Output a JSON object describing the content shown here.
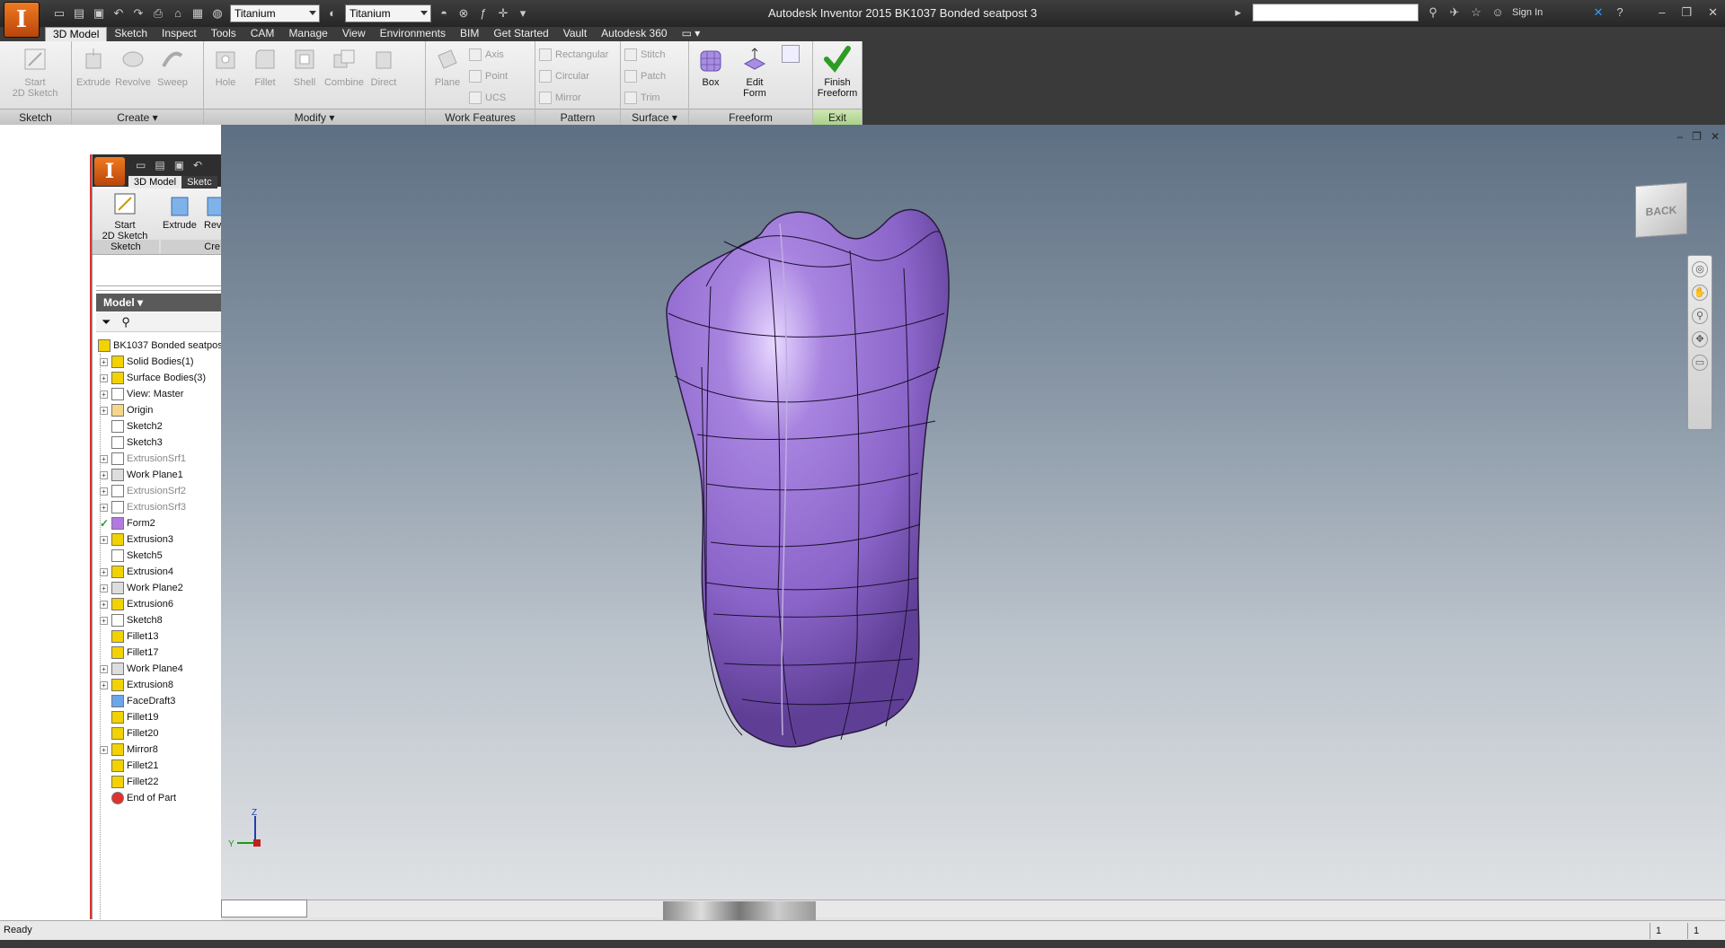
{
  "window": {
    "title": "Autodesk Inventor 2015   BK1037 Bonded seatpost 3",
    "material": "Titanium",
    "appearance": "Titanium",
    "sign_in": "Sign In",
    "search_placeholder": ""
  },
  "tabs": [
    "3D Model",
    "Sketch",
    "Inspect",
    "Tools",
    "CAM",
    "Manage",
    "View",
    "Environments",
    "BIM",
    "Get Started",
    "Vault",
    "Autodesk 360"
  ],
  "ribbon": {
    "sketch": {
      "start": "Start\n2D Sketch",
      "label": "Sketch"
    },
    "create": {
      "tools": [
        "Extrude",
        "Revolve",
        "Sweep"
      ],
      "label": "Create"
    },
    "modify": {
      "tools": [
        "Hole",
        "Fillet",
        "Shell",
        "Combine",
        "Direct"
      ],
      "label": "Modify"
    },
    "work": {
      "plane": "Plane",
      "axis": "Axis",
      "point": "Point",
      "ucs": "UCS",
      "label": "Work Features"
    },
    "pattern": {
      "rect": "Rectangular",
      "circ": "Circular",
      "mirror": "Mirror",
      "label": "Pattern"
    },
    "surface": {
      "stitch": "Stitch",
      "patch": "Patch",
      "trim": "Trim",
      "label": "Surface"
    },
    "freeform": {
      "box": "Box",
      "edit_form": "Edit\nForm",
      "label": "Freeform"
    },
    "exit": {
      "finish": "Finish\nFreeform",
      "label": "Exit"
    }
  },
  "inner": {
    "tab1": "3D Model",
    "tab2": "Sketc",
    "start": "Start\n2D Sketch",
    "extrude": "Extrude",
    "rev": "Rev",
    "sketch_label": "Sketch",
    "create_label": "Cre"
  },
  "browser": {
    "header": "Model",
    "root": "BK1037 Bonded seatpos",
    "nodes": [
      {
        "label": "Solid Bodies(1)",
        "expand": true,
        "dim": false,
        "color": "#f2d200"
      },
      {
        "label": "Surface Bodies(3)",
        "expand": true,
        "dim": false,
        "color": "#f2d200"
      },
      {
        "label": "View: Master",
        "expand": true,
        "dim": false,
        "color": "#ffffff"
      },
      {
        "label": "Origin",
        "expand": true,
        "dim": false,
        "color": "#f5d68a"
      },
      {
        "label": "Sketch2",
        "expand": false,
        "dim": false,
        "color": "#ffffff"
      },
      {
        "label": "Sketch3",
        "expand": false,
        "dim": false,
        "color": "#ffffff"
      },
      {
        "label": "ExtrusionSrf1",
        "expand": true,
        "dim": true,
        "color": "#ffffff"
      },
      {
        "label": "Work Plane1",
        "expand": true,
        "dim": false,
        "color": "#dddddd"
      },
      {
        "label": "ExtrusionSrf2",
        "expand": true,
        "dim": true,
        "color": "#ffffff"
      },
      {
        "label": "ExtrusionSrf3",
        "expand": true,
        "dim": true,
        "color": "#ffffff"
      },
      {
        "label": "Form2",
        "expand": false,
        "dim": false,
        "color": "#b27ae0",
        "check": true
      },
      {
        "label": "Extrusion3",
        "expand": true,
        "dim": false,
        "color": "#f2d200"
      },
      {
        "label": "Sketch5",
        "expand": false,
        "dim": false,
        "color": "#ffffff"
      },
      {
        "label": "Extrusion4",
        "expand": true,
        "dim": false,
        "color": "#f2d200"
      },
      {
        "label": "Work Plane2",
        "expand": true,
        "dim": false,
        "color": "#dddddd"
      },
      {
        "label": "Extrusion6",
        "expand": true,
        "dim": false,
        "color": "#f2d200"
      },
      {
        "label": "Sketch8",
        "expand": true,
        "dim": false,
        "color": "#ffffff"
      },
      {
        "label": "Fillet13",
        "expand": false,
        "dim": false,
        "color": "#f2d200"
      },
      {
        "label": "Fillet17",
        "expand": false,
        "dim": false,
        "color": "#f2d200"
      },
      {
        "label": "Work Plane4",
        "expand": true,
        "dim": false,
        "color": "#dddddd"
      },
      {
        "label": "Extrusion8",
        "expand": true,
        "dim": false,
        "color": "#f2d200"
      },
      {
        "label": "FaceDraft3",
        "expand": false,
        "dim": false,
        "color": "#6aa6e8"
      },
      {
        "label": "Fillet19",
        "expand": false,
        "dim": false,
        "color": "#f2d200"
      },
      {
        "label": "Fillet20",
        "expand": false,
        "dim": false,
        "color": "#f2d200"
      },
      {
        "label": "Mirror8",
        "expand": true,
        "dim": false,
        "color": "#f2d200"
      },
      {
        "label": "Fillet21",
        "expand": false,
        "dim": false,
        "color": "#f2d200"
      },
      {
        "label": "Fillet22",
        "expand": false,
        "dim": false,
        "color": "#f2d200"
      },
      {
        "label": "End of Part",
        "expand": false,
        "dim": false,
        "color": "#e03030"
      }
    ]
  },
  "viewport": {
    "viewcube": "BACK",
    "axis_z": "Z",
    "axis_y": "Y"
  },
  "status": {
    "text": "Ready",
    "cell1": "1",
    "cell2": "1"
  },
  "colors": {
    "form": "#9b7ad0",
    "accent": "#e8731c",
    "finish": "#2e9b25"
  }
}
